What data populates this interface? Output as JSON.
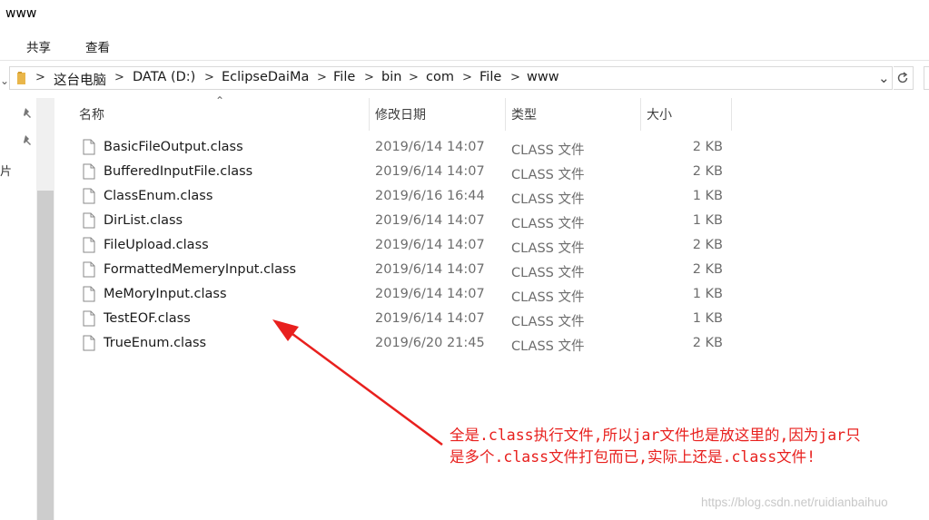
{
  "window": {
    "title": "www"
  },
  "ribbon": {
    "tabs": [
      {
        "label": "共享"
      },
      {
        "label": "查看"
      }
    ]
  },
  "address": {
    "crumbs": [
      "这台电脑",
      "DATA (D:)",
      "EclipseDaiMa",
      "File",
      "bin",
      "com",
      "File",
      "www"
    ],
    "icons": {
      "folder": "folder-icon",
      "dropdown": "chevron-down-icon",
      "refresh": "refresh-icon"
    }
  },
  "nav": {
    "partial_glyph": "片",
    "icons": [
      "pin-icon",
      "pin-icon"
    ]
  },
  "columns": {
    "name": "名称",
    "date": "修改日期",
    "type": "类型",
    "size": "大小",
    "sorted_by": "name"
  },
  "files": [
    {
      "name": "BasicFileOutput.class",
      "date": "2019/6/14 14:07",
      "type": "CLASS 文件",
      "size": "2 KB"
    },
    {
      "name": "BufferedInputFile.class",
      "date": "2019/6/14 14:07",
      "type": "CLASS 文件",
      "size": "2 KB"
    },
    {
      "name": "ClassEnum.class",
      "date": "2019/6/16 16:44",
      "type": "CLASS 文件",
      "size": "1 KB"
    },
    {
      "name": "DirList.class",
      "date": "2019/6/14 14:07",
      "type": "CLASS 文件",
      "size": "1 KB"
    },
    {
      "name": "FileUpload.class",
      "date": "2019/6/14 14:07",
      "type": "CLASS 文件",
      "size": "2 KB"
    },
    {
      "name": "FormattedMemeryInput.class",
      "date": "2019/6/14 14:07",
      "type": "CLASS 文件",
      "size": "2 KB"
    },
    {
      "name": "MeMoryInput.class",
      "date": "2019/6/14 14:07",
      "type": "CLASS 文件",
      "size": "1 KB"
    },
    {
      "name": "TestEOF.class",
      "date": "2019/6/14 14:07",
      "type": "CLASS 文件",
      "size": "1 KB"
    },
    {
      "name": "TrueEnum.class",
      "date": "2019/6/20 21:45",
      "type": "CLASS 文件",
      "size": "2 KB"
    }
  ],
  "annotation": {
    "line1": "全是.class执行文件,所以jar文件也是放这里的,因为jar只",
    "line2": "是多个.class文件打包而已,实际上还是.class文件!",
    "color": "#e8201e"
  },
  "watermark": "https://blog.csdn.net/ruidianbaihuo"
}
